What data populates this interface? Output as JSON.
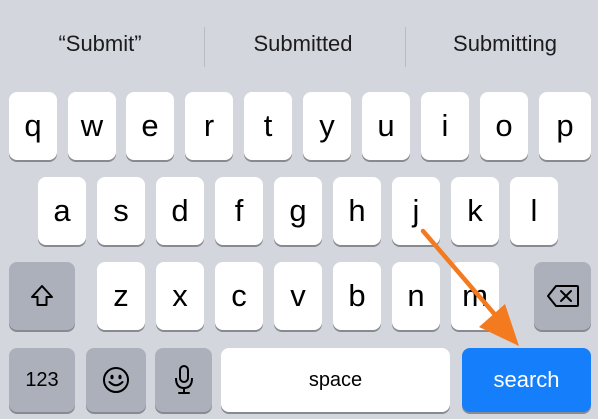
{
  "suggestions": [
    "“Submit”",
    "Submitted",
    "Submitting"
  ],
  "rows": {
    "row1": [
      "q",
      "w",
      "e",
      "r",
      "t",
      "y",
      "u",
      "i",
      "o",
      "p"
    ],
    "row2": [
      "a",
      "s",
      "d",
      "f",
      "g",
      "h",
      "j",
      "k",
      "l"
    ],
    "row3": [
      "z",
      "x",
      "c",
      "v",
      "b",
      "n",
      "m"
    ]
  },
  "bottom": {
    "numbers_label": "123",
    "space_label": "space",
    "search_label": "search"
  },
  "icons": {
    "shift": "shift-icon",
    "delete": "delete-icon",
    "emoji": "emoji-icon",
    "microphone": "microphone-icon"
  },
  "colors": {
    "keyboard_bg": "#d3d6dc",
    "key": "#ffffff",
    "function_key": "#abb0ba",
    "accent": "#147efb",
    "annotation_arrow": "#f47a20"
  }
}
